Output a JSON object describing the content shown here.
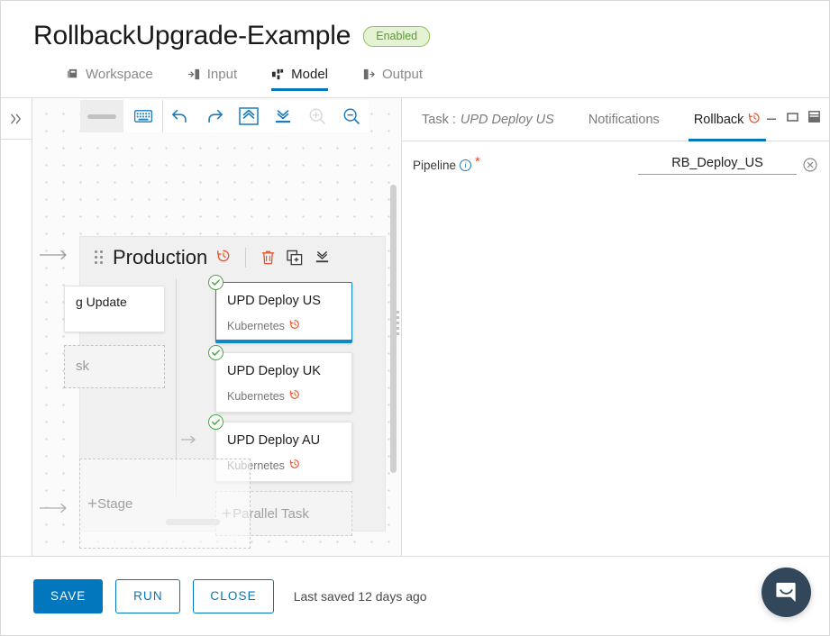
{
  "header": {
    "title": "RollbackUpgrade-Example",
    "status_badge": "Enabled",
    "status_badge_color": "#8cc152",
    "tabs": [
      {
        "label": "Workspace",
        "icon": "workspace-icon",
        "active": false
      },
      {
        "label": "Input",
        "icon": "input-icon",
        "active": false
      },
      {
        "label": "Model",
        "icon": "model-icon",
        "active": true
      },
      {
        "label": "Output",
        "icon": "output-icon",
        "active": false
      }
    ]
  },
  "rail": {
    "expand_icon": "double-chevron-right-icon"
  },
  "toolbar": {
    "zoom_slider": "zoom-slider",
    "buttons": [
      {
        "name": "keyboard-shortcuts",
        "icon": "keyboard-icon",
        "disabled": false
      },
      {
        "name": "undo",
        "icon": "undo-arrow-icon",
        "disabled": false
      },
      {
        "name": "redo",
        "icon": "redo-arrow-icon",
        "disabled": false
      },
      {
        "name": "collapse-all",
        "icon": "chevron-up-box-icon",
        "disabled": false
      },
      {
        "name": "expand-all",
        "icon": "chevron-down-bar-icon",
        "disabled": false
      },
      {
        "name": "zoom-in",
        "icon": "magnifier-plus-icon",
        "disabled": true
      },
      {
        "name": "zoom-out",
        "icon": "magnifier-minus-icon",
        "disabled": false
      }
    ]
  },
  "canvas": {
    "stage": {
      "name": "Production",
      "rollback_icon": "rollback-clock-icon",
      "tools": [
        {
          "name": "delete-stage",
          "icon": "trash-icon",
          "color": "#e8552d"
        },
        {
          "name": "duplicate-stage",
          "icon": "copy-plus-icon",
          "color": "#3c3c3c"
        },
        {
          "name": "collapse-stage",
          "icon": "collapse-bar-icon",
          "color": "#3c3c3c"
        }
      ],
      "left_column": {
        "partial_card_label": "g Update",
        "partial_dashed_label": "sk"
      },
      "tasks": [
        {
          "title": "UPD Deploy US",
          "subtitle": "Kubernetes",
          "status": "checked",
          "selected": true
        },
        {
          "title": "UPD Deploy UK",
          "subtitle": "Kubernetes",
          "status": "checked",
          "selected": false
        },
        {
          "title": "UPD Deploy AU",
          "subtitle": "Kubernetes",
          "status": "checked",
          "selected": false
        }
      ],
      "add_parallel_task_label": "Parallel Task",
      "add_plus": "+"
    },
    "add_stage_label": "Stage",
    "add_stage_plus": "+"
  },
  "right_panel": {
    "tabs": [
      {
        "label": "Task :",
        "value": "UPD Deploy US",
        "active": false,
        "name": "tab-task"
      },
      {
        "label": "Notifications",
        "value": "",
        "active": false,
        "name": "tab-notifications"
      },
      {
        "label": "Rollback",
        "value": "",
        "active": true,
        "name": "tab-rollback",
        "icon": "rollback-clock-icon"
      }
    ],
    "window_controls": [
      {
        "name": "minimize-panel",
        "icon": "minimize-icon"
      },
      {
        "name": "maximize-panel",
        "icon": "maximize-icon"
      },
      {
        "name": "split-panel",
        "icon": "split-pane-icon"
      }
    ],
    "form": {
      "field_label": "Pipeline",
      "info_icon": "info-icon",
      "required_marker": "*",
      "value": "RB_Deploy_US",
      "placeholder": "",
      "clear_icon": "clear-circle-x-icon"
    }
  },
  "footer": {
    "save_label": "SAVE",
    "run_label": "RUN",
    "close_label": "CLOSE",
    "last_saved": "Last saved 12 days ago",
    "primary_color": "#0277bd"
  },
  "chat": {
    "icon": "chat-bubble-icon",
    "color": "#33475b"
  }
}
